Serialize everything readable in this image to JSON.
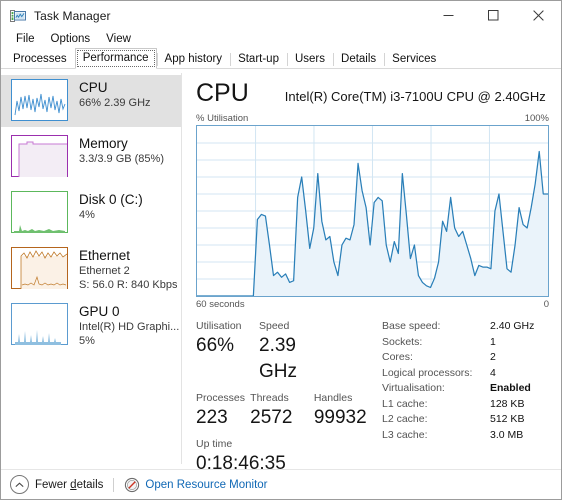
{
  "window": {
    "title": "Task Manager",
    "icon": "task-manager-icon",
    "minimize_label": "—",
    "maximize_label": "□",
    "close_label": "✕"
  },
  "menu": {
    "items": [
      {
        "label": "File"
      },
      {
        "label": "Options"
      },
      {
        "label": "View"
      }
    ]
  },
  "tabs": [
    {
      "label": "Processes",
      "active": false
    },
    {
      "label": "Performance",
      "active": true
    },
    {
      "label": "App history",
      "active": false
    },
    {
      "label": "Start-up",
      "active": false
    },
    {
      "label": "Users",
      "active": false
    },
    {
      "label": "Details",
      "active": false
    },
    {
      "label": "Services",
      "active": false
    }
  ],
  "sidebar": {
    "items": [
      {
        "name": "CPU",
        "line2": "66%  2.39 GHz",
        "line3": "",
        "selected": true,
        "color": "#3f8fd0"
      },
      {
        "name": "Memory",
        "line2": "3.3/3.9 GB (85%)",
        "line3": "",
        "selected": false,
        "color": "#9b2fae"
      },
      {
        "name": "Disk 0 (C:)",
        "line2": "4%",
        "line3": "",
        "selected": false,
        "color": "#5cb85c"
      },
      {
        "name": "Ethernet",
        "line2": "Ethernet 2",
        "line3": "S: 56.0 R: 840 Kbps",
        "selected": false,
        "color": "#b5651d"
      },
      {
        "name": "GPU 0",
        "line2": "Intel(R) HD Graphi...",
        "line3": "5%",
        "selected": false,
        "color": "#3f8fd0"
      }
    ]
  },
  "main": {
    "title": "CPU",
    "subtitle": "Intel(R) Core(TM) i3-7100U CPU @ 2.40GHz",
    "graph_top_left_label": "% Utilisation",
    "graph_top_right_label": "100%",
    "graph_bottom_left_label": "60 seconds",
    "graph_bottom_right_label": "0",
    "accent_color": "#4a9fd4",
    "stats_left": [
      {
        "label": "Utilisation",
        "value": "66%"
      },
      {
        "label": "Speed",
        "value": "2.39 GHz"
      },
      {
        "label": "Processes",
        "value": "223"
      },
      {
        "label": "Threads",
        "value": "2572"
      },
      {
        "label": "Handles",
        "value": "99932"
      },
      {
        "label": "Up time",
        "value": "0:18:46:35"
      }
    ],
    "specs": [
      {
        "label": "Base speed:",
        "value": "2.40 GHz",
        "bold": false
      },
      {
        "label": "Sockets:",
        "value": "1",
        "bold": false
      },
      {
        "label": "Cores:",
        "value": "2",
        "bold": false
      },
      {
        "label": "Logical processors:",
        "value": "4",
        "bold": false
      },
      {
        "label": "Virtualisation:",
        "value": "Enabled",
        "bold": true
      },
      {
        "label": "L1 cache:",
        "value": "128 KB",
        "bold": false
      },
      {
        "label": "L2 cache:",
        "value": "512 KB",
        "bold": false
      },
      {
        "label": "L3 cache:",
        "value": "3.0 MB",
        "bold": false
      }
    ]
  },
  "statusbar": {
    "fewer_details_pre": "Fewer ",
    "fewer_details_key": "d",
    "fewer_details_post": "etails",
    "resource_monitor_label": "Open Resource Monitor",
    "link_color": "#1068b5"
  },
  "chart_data": {
    "type": "area",
    "title": "CPU % Utilisation over 60 seconds",
    "xlabel": "60 seconds",
    "ylabel": "% Utilisation",
    "ylim": [
      0,
      100
    ],
    "xlim": [
      60,
      0
    ],
    "grid": true,
    "grid_rows": 10,
    "grid_cols": 6,
    "series_color": "#2a7fb8",
    "fill_color": "#eaf3fa",
    "current_value": 66,
    "values": [
      0,
      0,
      0,
      0,
      0,
      0,
      0,
      0,
      0,
      0,
      0,
      0,
      0,
      0,
      0,
      45,
      48,
      47,
      30,
      12,
      14,
      11,
      13,
      8,
      9,
      58,
      70,
      50,
      28,
      40,
      72,
      44,
      33,
      35,
      20,
      12,
      30,
      34,
      33,
      46,
      78,
      62,
      52,
      30,
      55,
      58,
      56,
      30,
      20,
      32,
      25,
      72,
      48,
      22,
      30,
      12,
      8,
      6,
      5,
      7,
      20,
      44,
      38,
      55,
      40,
      35,
      38,
      30,
      22,
      12,
      18,
      17,
      17,
      16,
      50,
      60,
      38,
      18,
      14,
      30,
      48,
      40,
      38,
      52,
      66,
      85,
      60
    ]
  }
}
